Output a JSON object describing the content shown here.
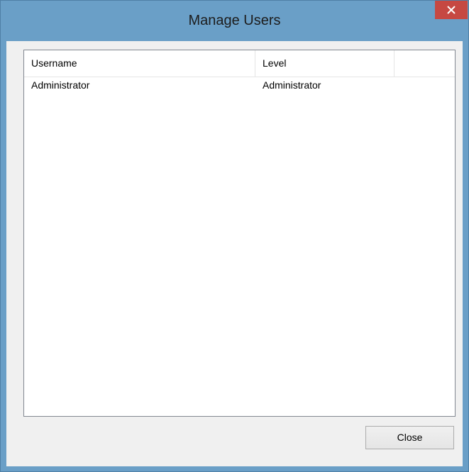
{
  "window": {
    "title": "Manage Users",
    "colors": {
      "frame": "#6a9fc7",
      "close_button": "#c64842",
      "client": "#f0f0f0"
    }
  },
  "users_list": {
    "columns": [
      "Username",
      "Level"
    ],
    "rows": [
      {
        "username": "Administrator",
        "level": "Administrator"
      }
    ]
  },
  "buttons": {
    "close_label": "Close"
  },
  "icons": {
    "title_close": "close-icon"
  }
}
